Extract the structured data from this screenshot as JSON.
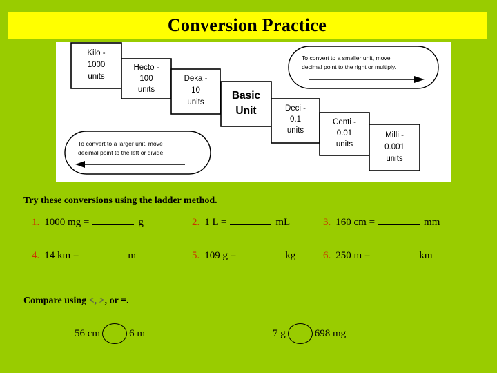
{
  "slide": {
    "title": "Conversion Practice",
    "background_color": "#99cc00",
    "banner_color": "#ffff00",
    "accent_color": "#cc3300"
  },
  "ladder": {
    "boxes": [
      {
        "name": "kilo",
        "line1": "Kilo -",
        "line2": "1000",
        "line3": "units"
      },
      {
        "name": "hecto",
        "line1": "Hecto -",
        "line2": "100",
        "line3": "units"
      },
      {
        "name": "deka",
        "line1": "Deka -",
        "line2": "10",
        "line3": "units"
      },
      {
        "name": "basic",
        "line1": "Basic",
        "line2": "Unit",
        "line3": ""
      },
      {
        "name": "deci",
        "line1": "Deci -",
        "line2": "0.1",
        "line3": "units"
      },
      {
        "name": "centi",
        "line1": "Centi -",
        "line2": "0.01",
        "line3": "units"
      },
      {
        "name": "milli",
        "line1": "Milli -",
        "line2": "0.001",
        "line3": "units"
      }
    ],
    "callout_left": {
      "line1": "To convert to a larger unit, move",
      "line2": "decimal  point to the left or divide.",
      "arrow": "left"
    },
    "callout_right": {
      "line1": "To convert to a smaller unit, move",
      "line2": "decimal  point to the right or multiply.",
      "arrow": "right"
    }
  },
  "practice": {
    "heading": "Try these conversions using the ladder method.",
    "problems": [
      {
        "num": "1.",
        "expr": "1000 mg =",
        "unit": "g"
      },
      {
        "num": "2.",
        "expr": "1 L =",
        "unit": "mL"
      },
      {
        "num": "3.",
        "expr": "160 cm =",
        "unit": "mm"
      },
      {
        "num": "4.",
        "expr": "14 km =",
        "unit": "m"
      },
      {
        "num": "5.",
        "expr": "109 g =",
        "unit": "kg"
      },
      {
        "num": "6.",
        "expr": "250 m =",
        "unit": "km"
      }
    ]
  },
  "compare": {
    "heading_pre": "Compare using ",
    "heading_symbols": "<, >",
    "heading_post": ", or =.",
    "items": [
      {
        "left": "56 cm",
        "right": "6 m"
      },
      {
        "left": "7 g",
        "right": "698 mg"
      }
    ]
  }
}
